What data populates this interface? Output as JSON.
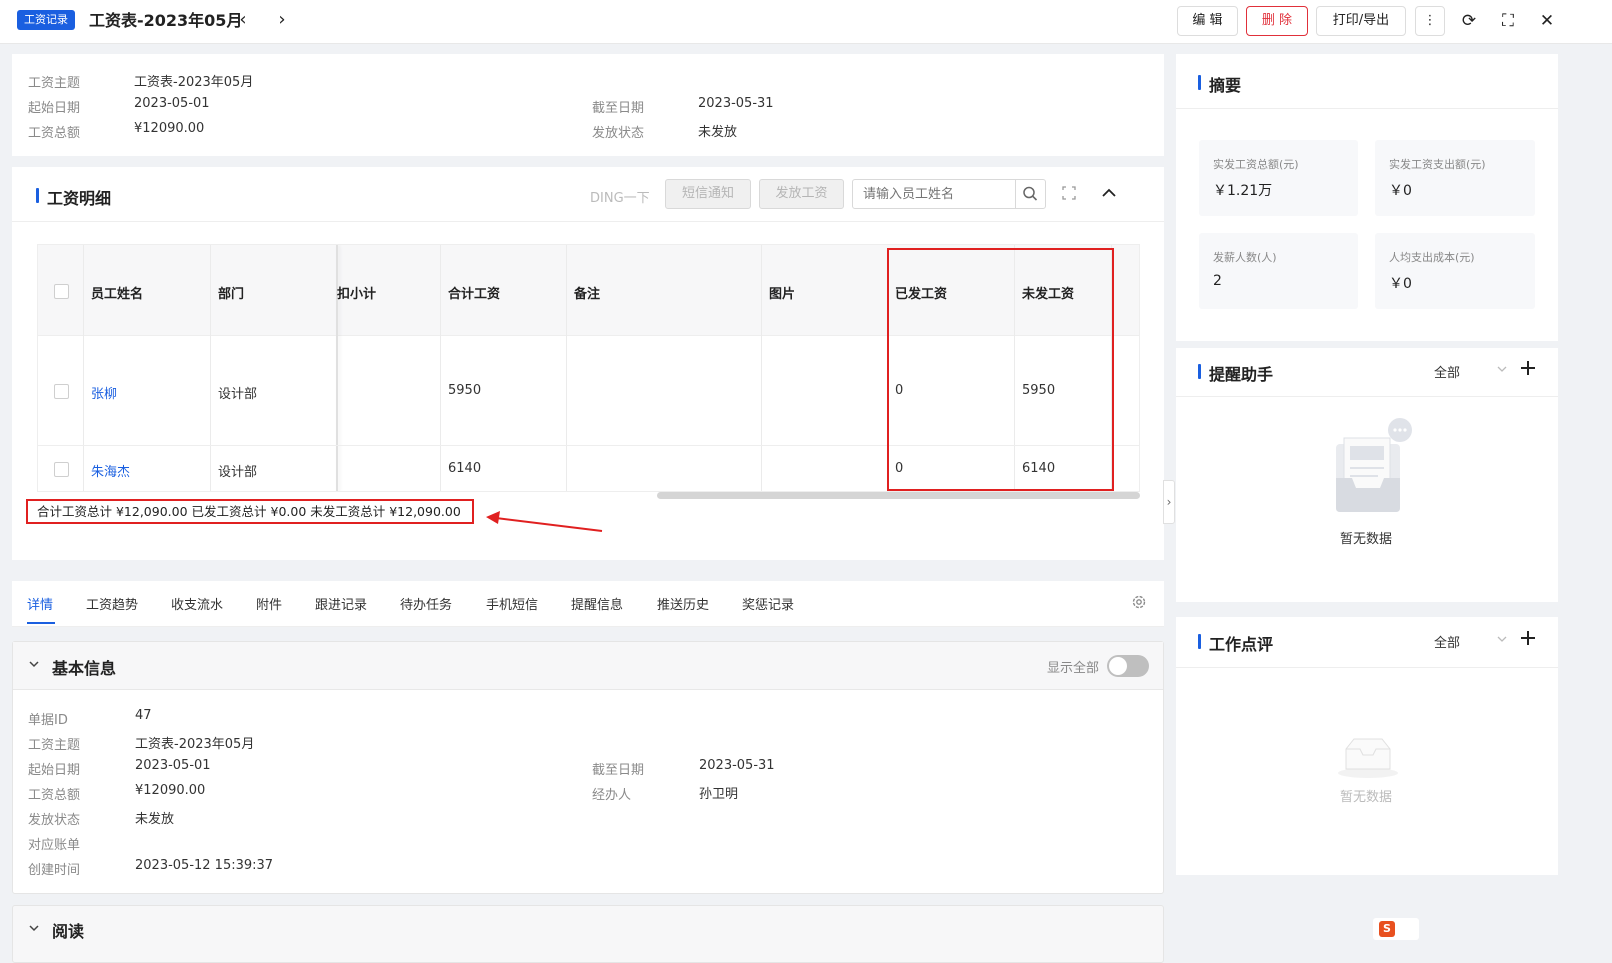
{
  "header": {
    "tag": "工资记录",
    "title": "工资表-2023年05月",
    "prev_icon": "‹",
    "next_icon": "›",
    "buttons": {
      "edit": "编 辑",
      "delete": "删 除",
      "print": "打印/导出"
    },
    "icons": {
      "more": "⋮",
      "refresh": "⟳",
      "fullscreen": "⛶",
      "close": "✕"
    }
  },
  "summary_info": {
    "subject_label": "工资主题",
    "subject_value": "工资表-2023年05月",
    "start_label": "起始日期",
    "start_value": "2023-05-01",
    "end_label": "截至日期",
    "end_value": "2023-05-31",
    "total_label": "工资总额",
    "total_value": "¥12090.00",
    "status_label": "发放状态",
    "status_value": "未发放"
  },
  "detail": {
    "title": "工资明细",
    "ding": "DING一下",
    "sms_button": "短信通知",
    "pay_button": "发放工资",
    "search_placeholder": "请输入员工姓名",
    "columns": [
      "员工姓名",
      "部门",
      "扣小计",
      "合计工资",
      "备注",
      "图片",
      "已发工资",
      "未发工资"
    ],
    "rows": [
      {
        "name": "张柳",
        "dept": "设计部",
        "deduct": "",
        "total": "5950",
        "remark": "",
        "image": "",
        "paid": "0",
        "unpaid": "5950"
      },
      {
        "name": "朱海杰",
        "dept": "设计部",
        "deduct": "",
        "total": "6140",
        "remark": "",
        "image": "",
        "paid": "0",
        "unpaid": "6140"
      }
    ],
    "footer_summary": "合计工资总计 ¥12,090.00 已发工资总计 ¥0.00 未发工资总计 ¥12,090.00"
  },
  "tabs": [
    "详情",
    "工资趋势",
    "收支流水",
    "附件",
    "跟进记录",
    "待办任务",
    "手机短信",
    "提醒信息",
    "推送历史",
    "奖惩记录"
  ],
  "basic_info": {
    "title": "基本信息",
    "show_all": "显示全部",
    "id_label": "单据ID",
    "id_value": "47",
    "subject_label": "工资主题",
    "subject_value": "工资表-2023年05月",
    "start_label": "起始日期",
    "start_value": "2023-05-01",
    "end_label": "截至日期",
    "end_value": "2023-05-31",
    "total_label": "工资总额",
    "total_value": "¥12090.00",
    "handler_label": "经办人",
    "handler_value": "孙卫明",
    "status_label": "发放状态",
    "status_value": "未发放",
    "bill_label": "对应账单",
    "bill_value": "",
    "created_label": "创建时间",
    "created_value": "2023-05-12 15:39:37"
  },
  "read_section": {
    "title": "阅读"
  },
  "abstract": {
    "title": "摘要",
    "cards": [
      {
        "label": "实发工资总额(元)",
        "value": "￥1.21万"
      },
      {
        "label": "实发工资支出额(元)",
        "value": "￥0"
      },
      {
        "label": "发薪人数(人)",
        "value": "2"
      },
      {
        "label": "人均支出成本(元)",
        "value": "￥0"
      }
    ]
  },
  "reminder": {
    "title": "提醒助手",
    "filter": "全部",
    "empty": "暂无数据"
  },
  "review": {
    "title": "工作点评",
    "filter": "全部",
    "empty": "暂无数据"
  }
}
